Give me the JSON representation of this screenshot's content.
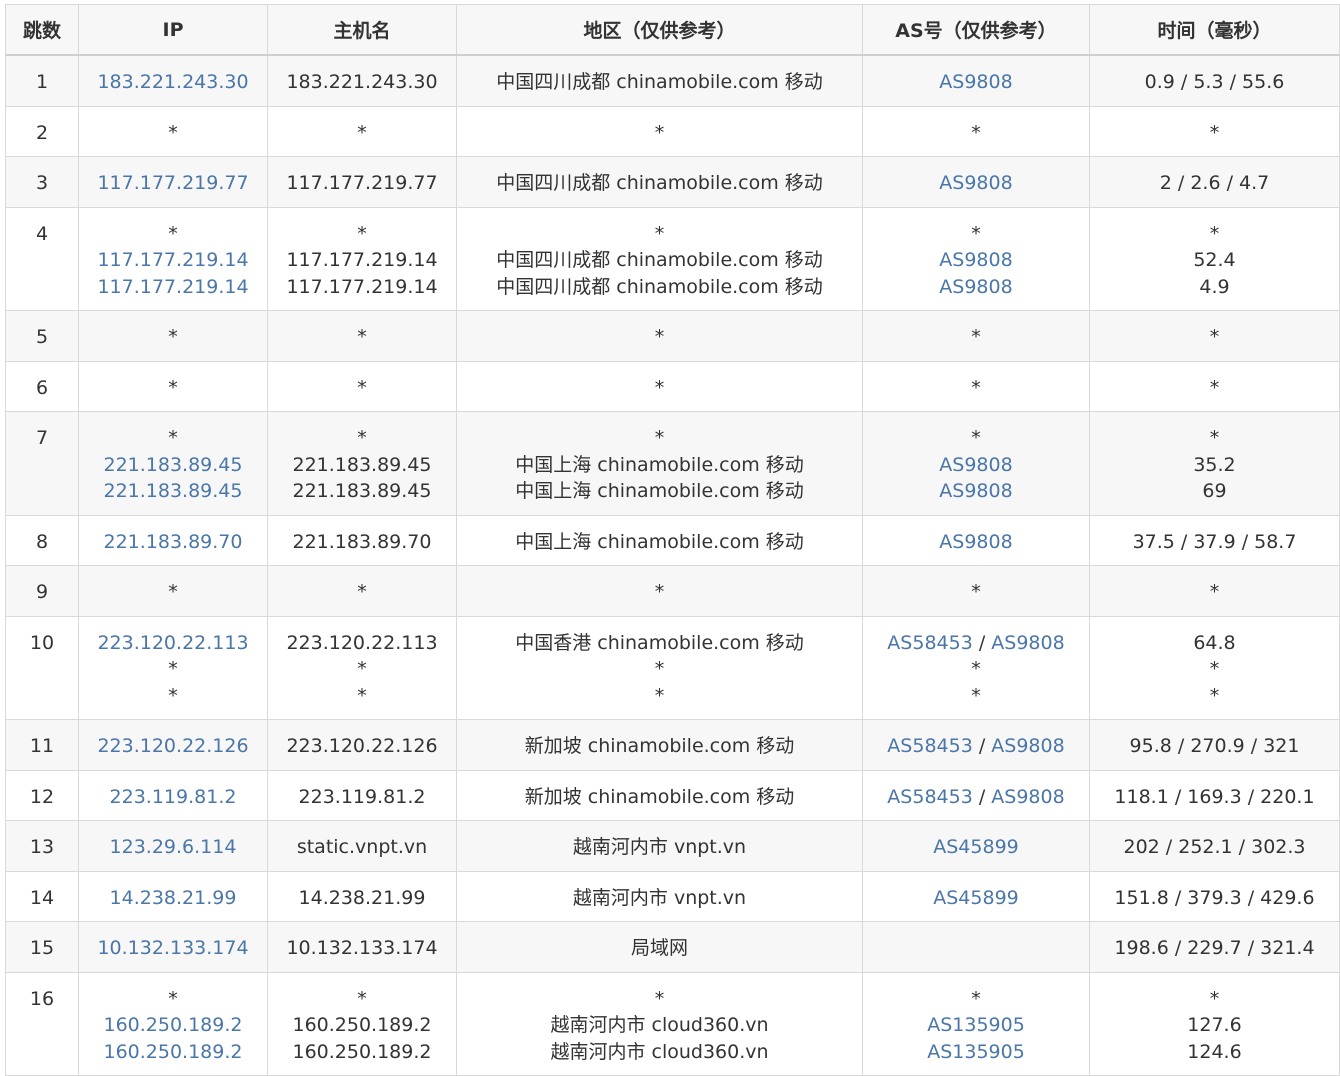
{
  "columns": [
    "跳数",
    "IP",
    "主机名",
    "地区（仅供参考）",
    "AS号（仅供参考）",
    "时间（毫秒）"
  ],
  "colors": {
    "link": "#4a76a8",
    "text": "#333333",
    "stripe": "#f7f7f7",
    "border": "#d9d9d9"
  },
  "rows": [
    {
      "hop": "1",
      "lines": [
        {
          "ip": "183.221.243.30",
          "host": "183.221.243.30",
          "region": "中国四川成都 chinamobile.com 移动",
          "as": [
            "AS9808"
          ],
          "time": "0.9 / 5.3 / 55.6"
        }
      ]
    },
    {
      "hop": "2",
      "lines": [
        {
          "ip": "*",
          "host": "*",
          "region": "*",
          "as": [
            "*"
          ],
          "time": "*"
        }
      ]
    },
    {
      "hop": "3",
      "lines": [
        {
          "ip": "117.177.219.77",
          "host": "117.177.219.77",
          "region": "中国四川成都 chinamobile.com 移动",
          "as": [
            "AS9808"
          ],
          "time": "2 / 2.6 / 4.7"
        }
      ]
    },
    {
      "hop": "4",
      "lines": [
        {
          "ip": "*",
          "host": "*",
          "region": "*",
          "as": [
            "*"
          ],
          "time": "*"
        },
        {
          "ip": "117.177.219.14",
          "host": "117.177.219.14",
          "region": "中国四川成都 chinamobile.com 移动",
          "as": [
            "AS9808"
          ],
          "time": "52.4"
        },
        {
          "ip": "117.177.219.14",
          "host": "117.177.219.14",
          "region": "中国四川成都 chinamobile.com 移动",
          "as": [
            "AS9808"
          ],
          "time": "4.9"
        }
      ]
    },
    {
      "hop": "5",
      "lines": [
        {
          "ip": "*",
          "host": "*",
          "region": "*",
          "as": [
            "*"
          ],
          "time": "*"
        }
      ]
    },
    {
      "hop": "6",
      "lines": [
        {
          "ip": "*",
          "host": "*",
          "region": "*",
          "as": [
            "*"
          ],
          "time": "*"
        }
      ]
    },
    {
      "hop": "7",
      "lines": [
        {
          "ip": "*",
          "host": "*",
          "region": "*",
          "as": [
            "*"
          ],
          "time": "*"
        },
        {
          "ip": "221.183.89.45",
          "host": "221.183.89.45",
          "region": "中国上海 chinamobile.com 移动",
          "as": [
            "AS9808"
          ],
          "time": "35.2"
        },
        {
          "ip": "221.183.89.45",
          "host": "221.183.89.45",
          "region": "中国上海 chinamobile.com 移动",
          "as": [
            "AS9808"
          ],
          "time": "69"
        }
      ]
    },
    {
      "hop": "8",
      "lines": [
        {
          "ip": "221.183.89.70",
          "host": "221.183.89.70",
          "region": "中国上海 chinamobile.com 移动",
          "as": [
            "AS9808"
          ],
          "time": "37.5 / 37.9 / 58.7"
        }
      ]
    },
    {
      "hop": "9",
      "lines": [
        {
          "ip": "*",
          "host": "*",
          "region": "*",
          "as": [
            "*"
          ],
          "time": "*"
        }
      ]
    },
    {
      "hop": "10",
      "lines": [
        {
          "ip": "223.120.22.113",
          "host": "223.120.22.113",
          "region": "中国香港 chinamobile.com 移动",
          "as": [
            "AS58453",
            "AS9808"
          ],
          "time": "64.8"
        },
        {
          "ip": "*",
          "host": "*",
          "region": "*",
          "as": [
            "*"
          ],
          "time": "*"
        },
        {
          "ip": "*",
          "host": "*",
          "region": "*",
          "as": [
            "*"
          ],
          "time": "*"
        }
      ]
    },
    {
      "hop": "11",
      "lines": [
        {
          "ip": "223.120.22.126",
          "host": "223.120.22.126",
          "region": "新加坡 chinamobile.com 移动",
          "as": [
            "AS58453",
            "AS9808"
          ],
          "time": "95.8 / 270.9 / 321"
        }
      ]
    },
    {
      "hop": "12",
      "lines": [
        {
          "ip": "223.119.81.2",
          "host": "223.119.81.2",
          "region": "新加坡 chinamobile.com 移动",
          "as": [
            "AS58453",
            "AS9808"
          ],
          "time": "118.1 / 169.3 / 220.1"
        }
      ]
    },
    {
      "hop": "13",
      "lines": [
        {
          "ip": "123.29.6.114",
          "host": "static.vnpt.vn",
          "region": "越南河内市 vnpt.vn",
          "as": [
            "AS45899"
          ],
          "time": "202 / 252.1 / 302.3"
        }
      ]
    },
    {
      "hop": "14",
      "lines": [
        {
          "ip": "14.238.21.99",
          "host": "14.238.21.99",
          "region": "越南河内市 vnpt.vn",
          "as": [
            "AS45899"
          ],
          "time": "151.8 / 379.3 / 429.6"
        }
      ]
    },
    {
      "hop": "15",
      "lines": [
        {
          "ip": "10.132.133.174",
          "host": "10.132.133.174",
          "region": "局域网",
          "as": [],
          "time": "198.6 / 229.7 / 321.4"
        }
      ]
    },
    {
      "hop": "16",
      "lines": [
        {
          "ip": "*",
          "host": "*",
          "region": "*",
          "as": [
            "*"
          ],
          "time": "*"
        },
        {
          "ip": "160.250.189.2",
          "host": "160.250.189.2",
          "region": "越南河内市 cloud360.vn",
          "as": [
            "AS135905"
          ],
          "time": "127.6"
        },
        {
          "ip": "160.250.189.2",
          "host": "160.250.189.2",
          "region": "越南河内市 cloud360.vn",
          "as": [
            "AS135905"
          ],
          "time": "124.6"
        }
      ]
    }
  ]
}
